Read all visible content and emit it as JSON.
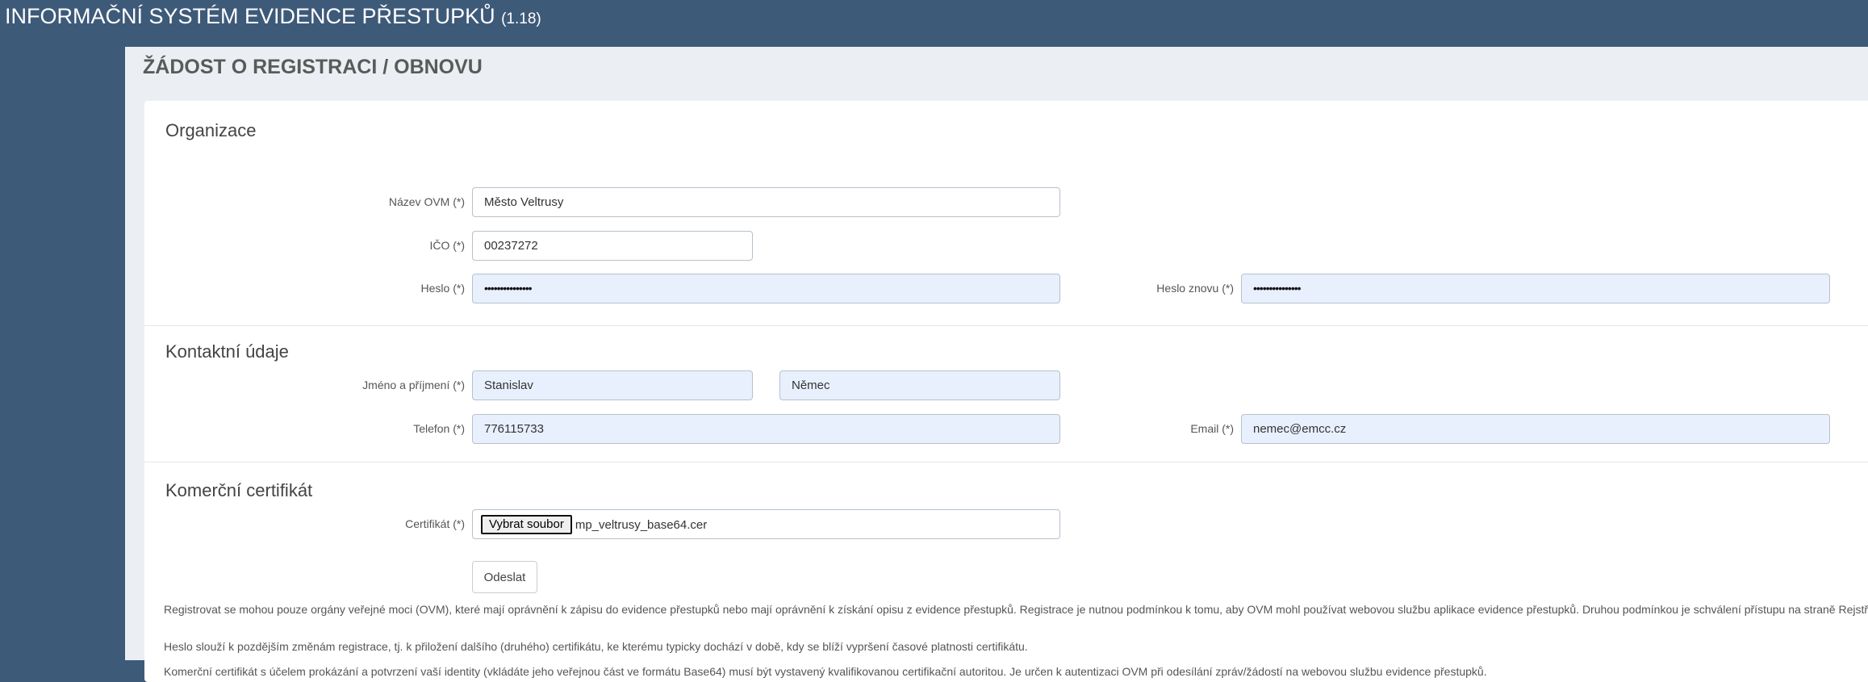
{
  "header": {
    "title": "INFORMAČNÍ SYSTÉM EVIDENCE PŘESTUPKŮ",
    "version": "(1.18)"
  },
  "page_title": "ŽÁDOST O REGISTRACI / OBNOVU",
  "organizace": {
    "heading": "Organizace",
    "nazev_label": "Název OVM (*)",
    "nazev_value": "Město Veltrusy",
    "ico_label": "IČO (*)",
    "ico_value": "00237272",
    "heslo_label": "Heslo (*)",
    "heslo_value": "•••••••••••••••",
    "heslo2_label": "Heslo znovu (*)",
    "heslo2_value": "•••••••••••••••"
  },
  "kontakt": {
    "heading": "Kontaktní údaje",
    "jmeno_label": "Jméno a příjmení (*)",
    "jmeno_value": "Stanislav",
    "prijmeni_value": "Němec",
    "telefon_label": "Telefon (*)",
    "telefon_value": "776115733",
    "email_label": "Email (*)",
    "email_value": "nemec@emcc.cz"
  },
  "certifikat": {
    "heading": "Komerční certifikát",
    "label": "Certifikát (*)",
    "button": "Vybrat soubor",
    "file": "mp_veltrusy_base64.cer"
  },
  "submit": "Odeslat",
  "info": [
    "Registrovat se mohou pouze orgány veřejné moci (OVM), které mají oprávnění k zápisu do evidence přestupků nebo mají oprávnění k získání opisu z evidence přestupků. Registrace je nutnou podmínkou k tomu, aby OVM mohl používat webovou službu aplikace evidence přestupků. Druhou podmínkou je schválení přístupu na straně Rejstříku trestů.",
    "Heslo slouží k pozdějším změnám registrace, tj. k přiložení dalšího (druhého) certifikátu, ke kterému typicky dochází v době, kdy se blíží vypršení časové platnosti certifikátu.",
    "Komerční certifikát s účelem prokázání a potvrzení vaší identity (vkládáte jeho veřejnou část ve formátu Base64) musí být vystavený kvalifikovanou certifikační autoritou. Je určen k autentizaci OVM při odesílání zpráv/žádostí na webovou službu evidence přestupků."
  ]
}
